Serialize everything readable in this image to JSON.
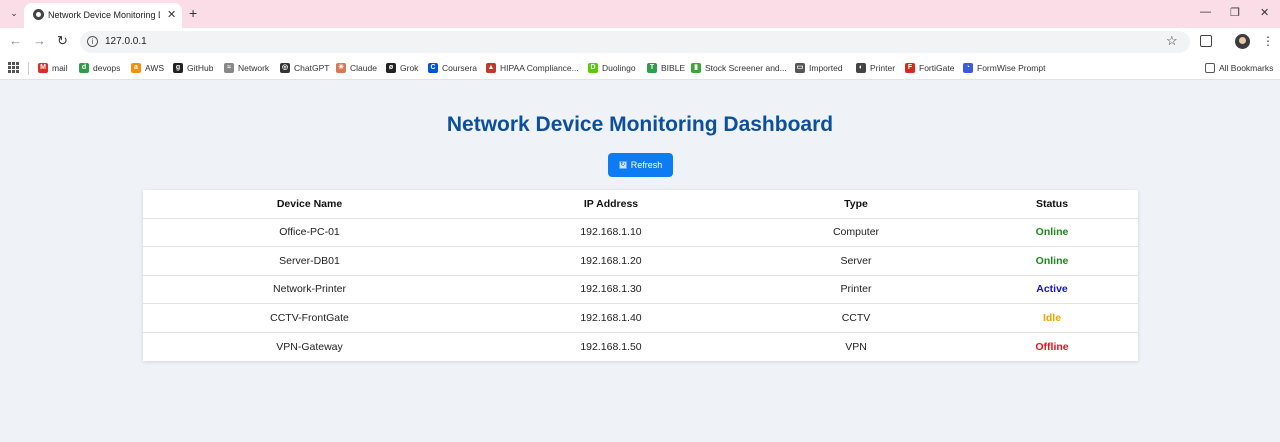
{
  "browser": {
    "tab_title": "Network Device Monitoring Da",
    "url": "127.0.0.1",
    "bookmarks": [
      {
        "label": "mail",
        "icon": "gmail-icon",
        "color": "#d93025",
        "glyph": "M"
      },
      {
        "label": "devops",
        "icon": "devops-icon",
        "color": "#2e9c4a",
        "glyph": "d"
      },
      {
        "label": "AWS",
        "icon": "aws-icon",
        "color": "#f29111",
        "glyph": "a"
      },
      {
        "label": "GitHub",
        "icon": "github-icon",
        "color": "#222222",
        "glyph": "g"
      },
      {
        "label": "Network",
        "icon": "network-icon",
        "color": "#888888",
        "glyph": "≈"
      },
      {
        "label": "ChatGPT",
        "icon": "chatgpt-icon",
        "color": "#333333",
        "glyph": "◎"
      },
      {
        "label": "Claude",
        "icon": "claude-icon",
        "color": "#d97757",
        "glyph": "✳"
      },
      {
        "label": "Grok",
        "icon": "grok-icon",
        "color": "#222222",
        "glyph": "ø"
      },
      {
        "label": "Coursera",
        "icon": "coursera-icon",
        "color": "#0056d2",
        "glyph": "C"
      },
      {
        "label": "HIPAA Compliance...",
        "icon": "hipaa-icon",
        "color": "#c0392b",
        "glyph": "▲"
      },
      {
        "label": "Duolingo",
        "icon": "duolingo-icon",
        "color": "#58cc02",
        "glyph": "D"
      },
      {
        "label": "BIBLE",
        "icon": "bible-icon",
        "color": "#2e9c4a",
        "glyph": "T"
      },
      {
        "label": "Stock Screener and...",
        "icon": "stock-screener-icon",
        "color": "#3aa635",
        "glyph": "▮"
      },
      {
        "label": "Imported",
        "icon": "folder-icon",
        "color": "#555555",
        "glyph": "▭"
      },
      {
        "label": "Printer",
        "icon": "printer-icon",
        "color": "#444444",
        "glyph": "◐"
      },
      {
        "label": "FortiGate",
        "icon": "fortigate-icon",
        "color": "#da291c",
        "glyph": "F"
      },
      {
        "label": "FormWise Prompt",
        "icon": "formwise-icon",
        "color": "#3b5bdb",
        "glyph": "◔"
      }
    ],
    "all_bookmarks": "All Bookmarks"
  },
  "page": {
    "title": "Network Device Monitoring Dashboard",
    "refresh_label": "Refresh"
  },
  "table": {
    "headers": [
      "Device Name",
      "IP Address",
      "Type",
      "Status"
    ],
    "rows": [
      {
        "name": "Office-PC-01",
        "ip": "192.168.1.10",
        "type": "Computer",
        "status": "Online",
        "status_color": "#1a8a1a"
      },
      {
        "name": "Server-DB01",
        "ip": "192.168.1.20",
        "type": "Server",
        "status": "Online",
        "status_color": "#1a8a1a"
      },
      {
        "name": "Network-Printer",
        "ip": "192.168.1.30",
        "type": "Printer",
        "status": "Active",
        "status_color": "#1515c8"
      },
      {
        "name": "CCTV-FrontGate",
        "ip": "192.168.1.40",
        "type": "CCTV",
        "status": "Idle",
        "status_color": "#f5a300"
      },
      {
        "name": "VPN-Gateway",
        "ip": "192.168.1.50",
        "type": "VPN",
        "status": "Offline",
        "status_color": "#e0141e"
      }
    ]
  },
  "colors": {
    "title": "#0b4f9e",
    "button": "#0d7cf2",
    "background": "#eff3f7",
    "tabstrip": "#fbdde7"
  }
}
